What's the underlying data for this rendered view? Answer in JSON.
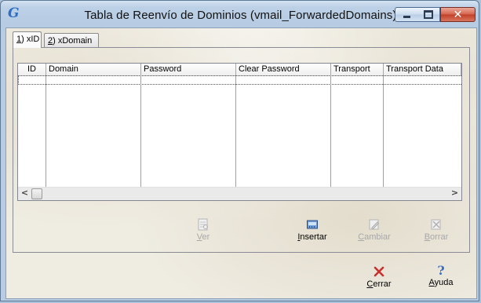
{
  "window": {
    "title": "Tabla de Reenvío de Dominios (vmail_ForwardedDomains)",
    "app_icon_glyph": "G"
  },
  "captions": {
    "close_glyph": "✕"
  },
  "tabs": [
    {
      "key": "1",
      "rest": ") xID"
    },
    {
      "key": "2",
      "rest": ") xDomain"
    }
  ],
  "grid": {
    "columns": [
      "ID",
      "Domain",
      "Password",
      "Clear Password",
      "Transport",
      "Transport Data"
    ],
    "rows": [],
    "scroll_left": "<",
    "scroll_right": ">"
  },
  "toolbar": {
    "ver": {
      "key": "V",
      "rest": "er",
      "enabled": false
    },
    "insertar": {
      "key": "I",
      "rest": "nsertar",
      "enabled": true
    },
    "cambiar": {
      "key": "C",
      "rest": "ambiar",
      "enabled": false
    },
    "borrar": {
      "key": "B",
      "rest": "orrar",
      "enabled": false
    }
  },
  "footer": {
    "cerrar": {
      "key": "C",
      "rest": "errar"
    },
    "ayuda": {
      "key": "A",
      "rest": "yuda"
    }
  },
  "colors": {
    "close_red": "#c92f2f",
    "help_blue": "#3a6fc8",
    "disabled_text": "#a8a8a8"
  }
}
